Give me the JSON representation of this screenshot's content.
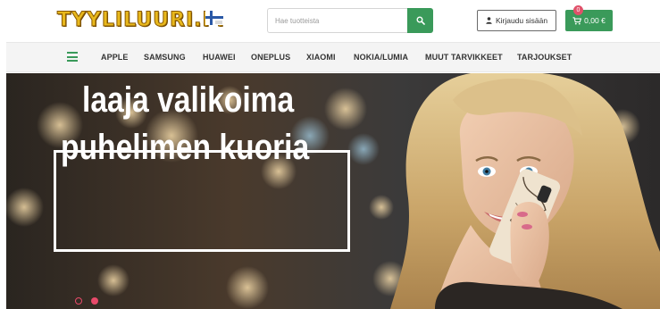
{
  "header": {
    "logo_text": "TYYLILUURI.FI",
    "search": {
      "placeholder": "Hae tuotteista",
      "value": ""
    },
    "login_label": "Kirjaudu sisään",
    "cart": {
      "total": "0,00 €",
      "count": "0"
    }
  },
  "nav": {
    "items": [
      {
        "label": "APPLE"
      },
      {
        "label": "SAMSUNG"
      },
      {
        "label": "HUAWEI"
      },
      {
        "label": "ONEPLUS"
      },
      {
        "label": "XIAOMI"
      },
      {
        "label": "NOKIA/LUMIA"
      },
      {
        "label": "MUUT TARVIKKEET"
      },
      {
        "label": "TARJOUKSET"
      }
    ]
  },
  "hero": {
    "line1": "laaja valikoima",
    "line2": "puhelimen kuoria",
    "slides_total": 2,
    "active_slide": 2
  },
  "colors": {
    "brand_green": "#3a9a5a",
    "logo_yellow": "#e8b81c",
    "accent_pink": "#e84a6a"
  },
  "icons": [
    "hamburger-menu-icon",
    "search-icon",
    "user-icon",
    "cart-icon",
    "finland-flag-icon"
  ]
}
